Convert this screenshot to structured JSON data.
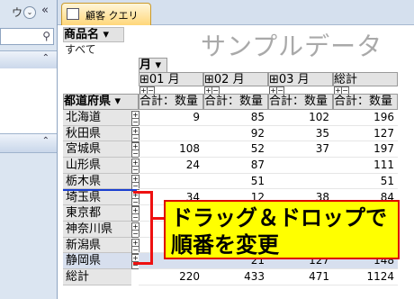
{
  "nav": {
    "title_fragment": "ウト",
    "dropdown_glyph": "⌄",
    "collapse_glyph": "«",
    "search_icon": "search-icon",
    "group_chevron_up": "⌃"
  },
  "tab": {
    "label": "顧客 クエリ"
  },
  "filter": {
    "field": "商品名",
    "arrow": "▾",
    "value": "すべて"
  },
  "title": "サンプルデータ",
  "column_field": {
    "label": "月",
    "arrow": "▾"
  },
  "column_groups": [
    {
      "label": "⊞01 月"
    },
    {
      "label": "⊞02 月"
    },
    {
      "label": "⊞03 月"
    },
    {
      "label": "総計"
    }
  ],
  "value_header": "合計：数量",
  "row_field": {
    "label": "都道府県",
    "arrow": "▾"
  },
  "rows": [
    {
      "name": "北海道",
      "v1": "9",
      "v2": "85",
      "v3": "102",
      "total": "196"
    },
    {
      "name": "秋田県",
      "v1": "",
      "v2": "92",
      "v3": "35",
      "total": "127"
    },
    {
      "name": "宮城県",
      "v1": "108",
      "v2": "52",
      "v3": "37",
      "total": "197"
    },
    {
      "name": "山形県",
      "v1": "24",
      "v2": "87",
      "v3": "",
      "total": "111"
    },
    {
      "name": "栃木県",
      "v1": "",
      "v2": "51",
      "v3": "",
      "total": "51"
    },
    {
      "name": "埼玉県",
      "v1": "34",
      "v2": "12",
      "v3": "38",
      "total": "84"
    },
    {
      "name": "東京都",
      "v1": "",
      "v2": "",
      "v3": "",
      "total": ""
    },
    {
      "name": "神奈川県",
      "v1": "",
      "v2": "",
      "v3": "",
      "total": ""
    },
    {
      "name": "新潟県",
      "v1": "",
      "v2": "",
      "v3": "",
      "total": ""
    },
    {
      "name": "静岡県",
      "v1": "",
      "v2": "21",
      "v3": "127",
      "total": "148"
    }
  ],
  "grand_total": {
    "name": "総計",
    "v1": "220",
    "v2": "433",
    "v3": "471",
    "total": "1124"
  },
  "callout": {
    "line1": "ドラッグ＆ドロップで",
    "line2": "順番を変更"
  },
  "colors": {
    "callout_bg": "#ffff00",
    "bracket": "#e11111",
    "drop_line": "#1a3fd0",
    "tab_accent": "#ffd77a"
  }
}
